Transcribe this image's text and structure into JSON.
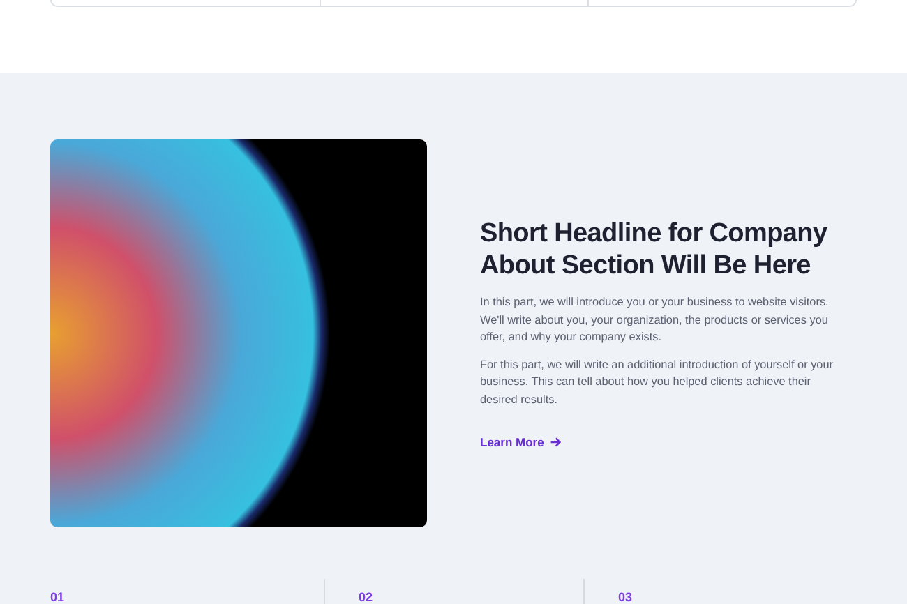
{
  "about": {
    "headline": "Short Headline for Company About Section Will Be Here",
    "paragraphs": [
      "In this part, we will introduce you or your business to website visitors. We'll write about you, your organization, the products or services you offer, and why your company exists.",
      "For this part, we will write an additional introduction of yourself or your business. This can tell about how you helped clients achieve their desired results."
    ],
    "link": {
      "label": "Learn More"
    }
  },
  "steps": [
    {
      "number": "01"
    },
    {
      "number": "02"
    },
    {
      "number": "03"
    }
  ]
}
